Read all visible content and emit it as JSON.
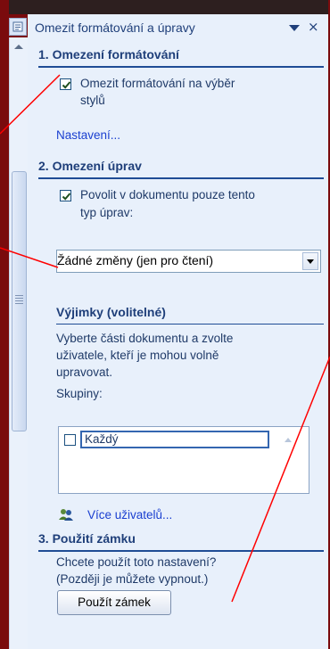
{
  "pane": {
    "title": "Omezit formátování a úpravy",
    "dropdown_icon": "chevron-down-icon",
    "close_glyph": "×"
  },
  "section1": {
    "heading": "1. Omezení formátování",
    "checkbox_checked": true,
    "checkbox_label_line1": "Omezit formátování na výběr",
    "checkbox_label_line2": "stylů",
    "settings_link": "Nastavení..."
  },
  "section2": {
    "heading": "2. Omezení úprav",
    "checkbox_checked": true,
    "checkbox_label_line1": "Povolit v dokumentu pouze tento",
    "checkbox_label_line2": "typ úprav:",
    "select_value": "Žádné změny (jen pro čtení)",
    "exceptions": {
      "heading": "Výjimky (volitelné)",
      "desc_line1": "Vyberte části dokumentu a zvolte",
      "desc_line2": "uživatele, kteří je mohou volně",
      "desc_line3": "upravovat.",
      "groups_label": "Skupiny:",
      "groups": [
        {
          "label": "Každý",
          "checked": false
        }
      ],
      "more_users_link": "Více uživatelů..."
    }
  },
  "section3": {
    "heading": "3. Použití zámku",
    "question_line1": "Chcete použít toto nastavení?",
    "question_line2": "(Později je můžete vypnout.)",
    "apply_button": "Použít zámek"
  },
  "colors": {
    "background": "#7a0b0d",
    "pane": "#e8f0fb",
    "heading": "#1f3f7a",
    "link": "#1a3fd0",
    "annotation_line": "#ff0000"
  }
}
